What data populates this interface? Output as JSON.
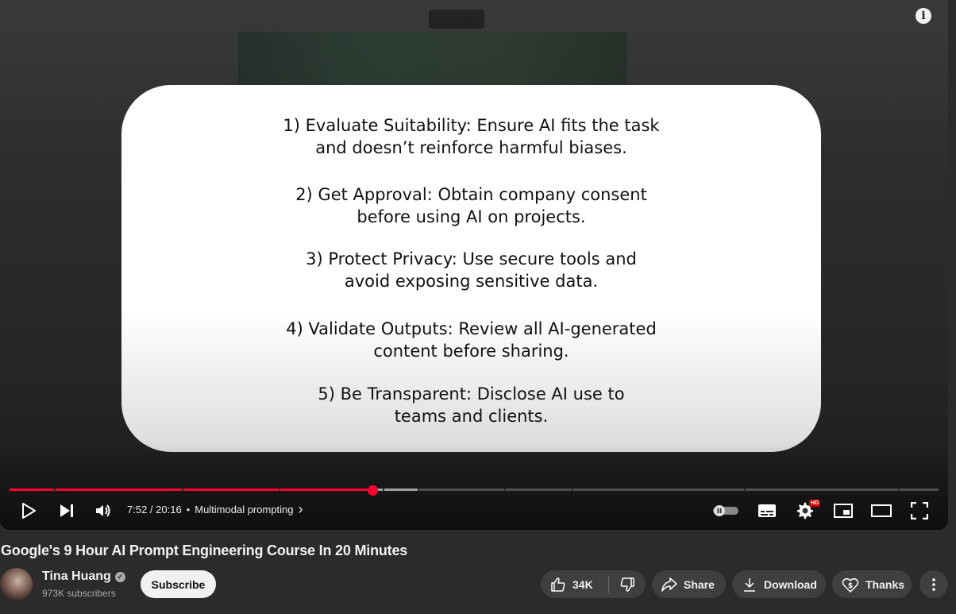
{
  "video": {
    "slide_items": [
      "1) Evaluate Suitability: Ensure AI fits the task\nand doesn’t reinforce harmful biases.",
      "2) Get Approval: Obtain company consent\nbefore using AI on projects.",
      "3) Protect Privacy: Use secure tools and\navoid exposing sensitive data.",
      "4) Validate Outputs: Review all AI-generated\ncontent before sharing.",
      "5) Be Transparent: Disclose AI use to\nteams and clients."
    ],
    "info_label": "i"
  },
  "player": {
    "played_fraction": 0.391,
    "buffered_fraction": 0.44,
    "time_display": "7:52 / 20:16",
    "chapter_separator": "•",
    "chapter_title": "Multimodal prompting",
    "chapter_arrow": "›",
    "hd_badge": "HD",
    "icons": [
      "play-icon",
      "next-icon",
      "volume-icon",
      "autoplay-toggle",
      "subtitles-icon",
      "settings-icon",
      "miniplayer-icon",
      "theater-icon",
      "fullscreen-icon"
    ]
  },
  "meta": {
    "title": "Google's 9 Hour AI Prompt Engineering Course In 20 Minutes",
    "channel_name": "Tina Huang",
    "verified_mark": "✓",
    "subscribers": "973K subscribers",
    "subscribe_label": "Subscribe",
    "like_count": "34K",
    "share_label": "Share",
    "download_label": "Download",
    "thanks_label": "Thanks"
  },
  "colors": {
    "progress_played": "#ff0033",
    "pill_background": "#3f3f3f",
    "subscribe_background": "#f1f1f1"
  }
}
